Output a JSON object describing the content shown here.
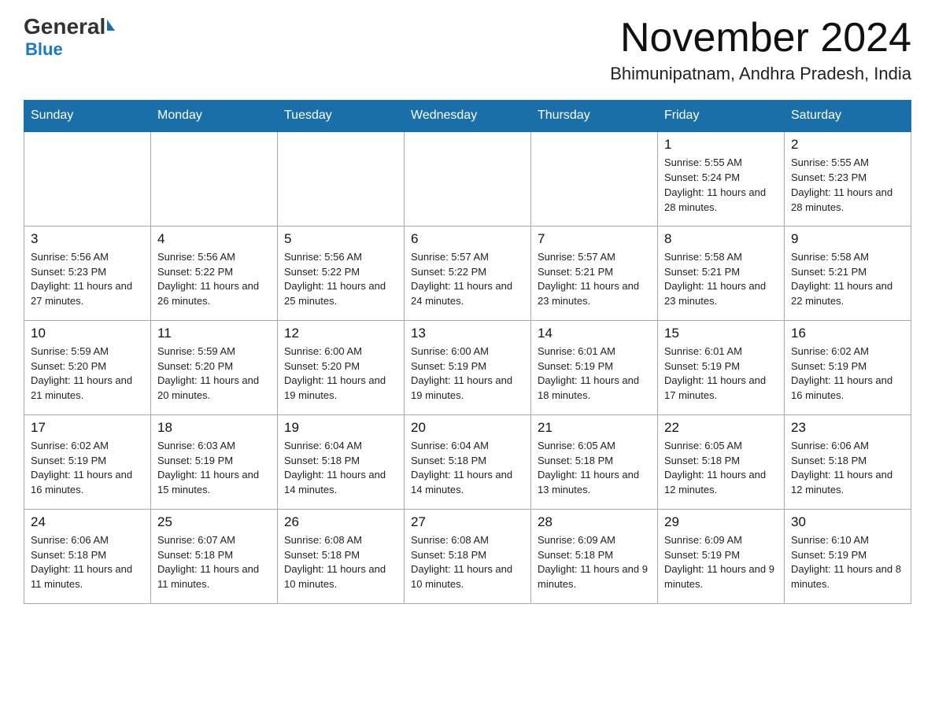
{
  "logo": {
    "general": "General",
    "blue": "Blue"
  },
  "header": {
    "month": "November 2024",
    "location": "Bhimunipatnam, Andhra Pradesh, India"
  },
  "weekdays": [
    "Sunday",
    "Monday",
    "Tuesday",
    "Wednesday",
    "Thursday",
    "Friday",
    "Saturday"
  ],
  "weeks": [
    [
      {
        "day": "",
        "info": ""
      },
      {
        "day": "",
        "info": ""
      },
      {
        "day": "",
        "info": ""
      },
      {
        "day": "",
        "info": ""
      },
      {
        "day": "",
        "info": ""
      },
      {
        "day": "1",
        "info": "Sunrise: 5:55 AM\nSunset: 5:24 PM\nDaylight: 11 hours\nand 28 minutes."
      },
      {
        "day": "2",
        "info": "Sunrise: 5:55 AM\nSunset: 5:23 PM\nDaylight: 11 hours\nand 28 minutes."
      }
    ],
    [
      {
        "day": "3",
        "info": "Sunrise: 5:56 AM\nSunset: 5:23 PM\nDaylight: 11 hours\nand 27 minutes."
      },
      {
        "day": "4",
        "info": "Sunrise: 5:56 AM\nSunset: 5:22 PM\nDaylight: 11 hours\nand 26 minutes."
      },
      {
        "day": "5",
        "info": "Sunrise: 5:56 AM\nSunset: 5:22 PM\nDaylight: 11 hours\nand 25 minutes."
      },
      {
        "day": "6",
        "info": "Sunrise: 5:57 AM\nSunset: 5:22 PM\nDaylight: 11 hours\nand 24 minutes."
      },
      {
        "day": "7",
        "info": "Sunrise: 5:57 AM\nSunset: 5:21 PM\nDaylight: 11 hours\nand 23 minutes."
      },
      {
        "day": "8",
        "info": "Sunrise: 5:58 AM\nSunset: 5:21 PM\nDaylight: 11 hours\nand 23 minutes."
      },
      {
        "day": "9",
        "info": "Sunrise: 5:58 AM\nSunset: 5:21 PM\nDaylight: 11 hours\nand 22 minutes."
      }
    ],
    [
      {
        "day": "10",
        "info": "Sunrise: 5:59 AM\nSunset: 5:20 PM\nDaylight: 11 hours\nand 21 minutes."
      },
      {
        "day": "11",
        "info": "Sunrise: 5:59 AM\nSunset: 5:20 PM\nDaylight: 11 hours\nand 20 minutes."
      },
      {
        "day": "12",
        "info": "Sunrise: 6:00 AM\nSunset: 5:20 PM\nDaylight: 11 hours\nand 19 minutes."
      },
      {
        "day": "13",
        "info": "Sunrise: 6:00 AM\nSunset: 5:19 PM\nDaylight: 11 hours\nand 19 minutes."
      },
      {
        "day": "14",
        "info": "Sunrise: 6:01 AM\nSunset: 5:19 PM\nDaylight: 11 hours\nand 18 minutes."
      },
      {
        "day": "15",
        "info": "Sunrise: 6:01 AM\nSunset: 5:19 PM\nDaylight: 11 hours\nand 17 minutes."
      },
      {
        "day": "16",
        "info": "Sunrise: 6:02 AM\nSunset: 5:19 PM\nDaylight: 11 hours\nand 16 minutes."
      }
    ],
    [
      {
        "day": "17",
        "info": "Sunrise: 6:02 AM\nSunset: 5:19 PM\nDaylight: 11 hours\nand 16 minutes."
      },
      {
        "day": "18",
        "info": "Sunrise: 6:03 AM\nSunset: 5:19 PM\nDaylight: 11 hours\nand 15 minutes."
      },
      {
        "day": "19",
        "info": "Sunrise: 6:04 AM\nSunset: 5:18 PM\nDaylight: 11 hours\nand 14 minutes."
      },
      {
        "day": "20",
        "info": "Sunrise: 6:04 AM\nSunset: 5:18 PM\nDaylight: 11 hours\nand 14 minutes."
      },
      {
        "day": "21",
        "info": "Sunrise: 6:05 AM\nSunset: 5:18 PM\nDaylight: 11 hours\nand 13 minutes."
      },
      {
        "day": "22",
        "info": "Sunrise: 6:05 AM\nSunset: 5:18 PM\nDaylight: 11 hours\nand 12 minutes."
      },
      {
        "day": "23",
        "info": "Sunrise: 6:06 AM\nSunset: 5:18 PM\nDaylight: 11 hours\nand 12 minutes."
      }
    ],
    [
      {
        "day": "24",
        "info": "Sunrise: 6:06 AM\nSunset: 5:18 PM\nDaylight: 11 hours\nand 11 minutes."
      },
      {
        "day": "25",
        "info": "Sunrise: 6:07 AM\nSunset: 5:18 PM\nDaylight: 11 hours\nand 11 minutes."
      },
      {
        "day": "26",
        "info": "Sunrise: 6:08 AM\nSunset: 5:18 PM\nDaylight: 11 hours\nand 10 minutes."
      },
      {
        "day": "27",
        "info": "Sunrise: 6:08 AM\nSunset: 5:18 PM\nDaylight: 11 hours\nand 10 minutes."
      },
      {
        "day": "28",
        "info": "Sunrise: 6:09 AM\nSunset: 5:18 PM\nDaylight: 11 hours\nand 9 minutes."
      },
      {
        "day": "29",
        "info": "Sunrise: 6:09 AM\nSunset: 5:19 PM\nDaylight: 11 hours\nand 9 minutes."
      },
      {
        "day": "30",
        "info": "Sunrise: 6:10 AM\nSunset: 5:19 PM\nDaylight: 11 hours\nand 8 minutes."
      }
    ]
  ]
}
